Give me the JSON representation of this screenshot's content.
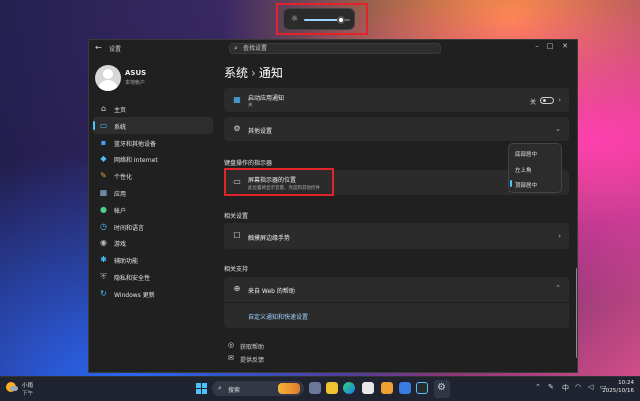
{
  "window": {
    "app_title": "设置",
    "search_placeholder": "查找设置",
    "minimize": "–",
    "maximize": "□",
    "close": "✕"
  },
  "user": {
    "name": "ASUS",
    "type": "本地帐户"
  },
  "sidebar": {
    "items": [
      {
        "label": "主页",
        "icon": "home-icon",
        "active": false
      },
      {
        "label": "系统",
        "icon": "monitor-icon",
        "active": true
      },
      {
        "label": "蓝牙和其他设备",
        "icon": "bluetooth-icon",
        "active": false
      },
      {
        "label": "网络和 Internet",
        "icon": "wifi-icon",
        "active": false
      },
      {
        "label": "个性化",
        "icon": "brush-icon",
        "active": false
      },
      {
        "label": "应用",
        "icon": "apps-icon",
        "active": false
      },
      {
        "label": "帐户",
        "icon": "person-icon",
        "active": false
      },
      {
        "label": "时间和语言",
        "icon": "clock-globe-icon",
        "active": false
      },
      {
        "label": "游戏",
        "icon": "gamepad-icon",
        "active": false
      },
      {
        "label": "辅助功能",
        "icon": "accessibility-icon",
        "active": false
      },
      {
        "label": "隐私和安全性",
        "icon": "shield-icon",
        "active": false
      },
      {
        "label": "Windows 更新",
        "icon": "update-icon",
        "active": false
      }
    ]
  },
  "breadcrumb": {
    "parent": "系统",
    "separator": "›",
    "current": "通知"
  },
  "content": {
    "startup_notify": {
      "title": "启动应用通知",
      "subtitle": "关",
      "toggle_label": "关",
      "toggle_on": false
    },
    "other_settings": {
      "title": "其他设置"
    },
    "indicator_section": "键盘操作的指示器",
    "indicator_position": {
      "title": "屏幕指示器的位置",
      "subtitle": "此位置将显示音量、亮度和其他控件"
    },
    "dropdown": {
      "options": [
        "底部居中",
        "左上角",
        "顶部居中"
      ],
      "selected": "顶部居中"
    },
    "related_settings": "相关设置",
    "touchpad": {
      "title": "触摸屏边缘手势"
    },
    "related_support": "相关支持",
    "web_help": {
      "title": "来自 Web 的帮助",
      "link": "自定义通知和快速设置"
    },
    "get_help": "获取帮助",
    "feedback": "提供反馈"
  },
  "flyout": {
    "brightness_level": 0.8
  },
  "taskbar": {
    "weather_title": "小雨",
    "weather_subtitle": "下午",
    "search_label": "搜索",
    "tray_lang": "中",
    "time": "10:24",
    "date": "2025/10/16"
  },
  "colors": {
    "accent": "#4cc2ff",
    "highlight_box": "#e0242a"
  }
}
